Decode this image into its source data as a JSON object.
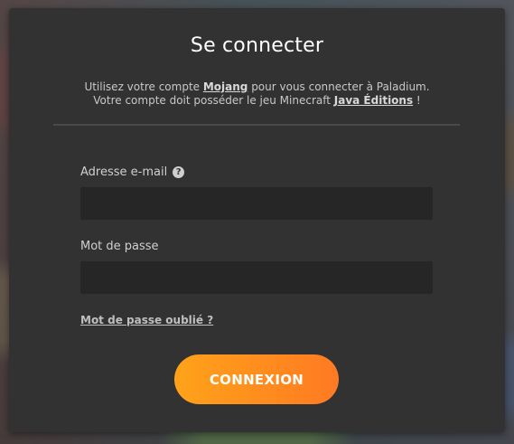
{
  "modal": {
    "title": "Se connecter",
    "subtitle": {
      "line1_prefix": "Utilisez votre compte ",
      "line1_link": "Mojang",
      "line1_suffix": " pour vous connecter à Paladium.",
      "line2_prefix": "Votre compte doit posséder le jeu Minecraft ",
      "line2_link": "Java Éditions",
      "line2_suffix": " !"
    },
    "email": {
      "label": "Adresse e-mail",
      "help_icon_glyph": "?",
      "value": "",
      "placeholder": ""
    },
    "password": {
      "label": "Mot de passe",
      "value": "",
      "placeholder": ""
    },
    "forgot_password": "Mot de passe oublié ?",
    "submit_label": "CONNEXION"
  },
  "colors": {
    "modal_bg": "#323232",
    "input_bg": "#262626",
    "accent_start": "#ffa31a",
    "accent_end": "#ff7a23"
  },
  "icons": {
    "help": "help-circle-icon"
  }
}
